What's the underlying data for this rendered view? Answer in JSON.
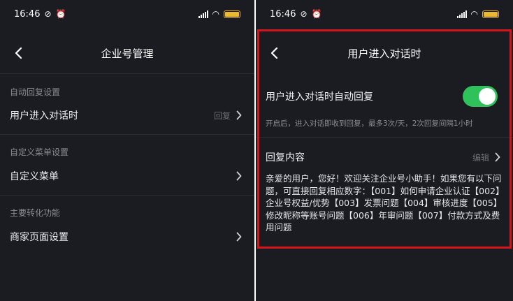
{
  "status_bar": {
    "time": "16:46",
    "icons": [
      "do-not-disturb-icon",
      "alarm-icon",
      "signal-icon",
      "wifi-icon",
      "battery-icon"
    ],
    "battery_color": "#e8b931"
  },
  "left_screen": {
    "nav": {
      "title": "企业号管理"
    },
    "sections": [
      {
        "header": "自动回复设置",
        "row_label": "用户进入对话时",
        "row_value": "回复"
      },
      {
        "header": "自定义菜单设置",
        "row_label": "自定义菜单",
        "row_value": ""
      },
      {
        "header": "主要转化功能",
        "row_label": "商家页面设置",
        "row_value": ""
      }
    ]
  },
  "right_screen": {
    "nav": {
      "title": "用户进入对话时"
    },
    "auto_reply": {
      "label": "用户进入对话时自动回复",
      "enabled": true,
      "hint": "开启后，进入对话即收到回复，最多3次/天，2次回复间隔1小时"
    },
    "reply_content": {
      "label": "回复内容",
      "action": "编辑",
      "text": "亲爱的用户，您好！欢迎关注企业号小助手！如果您有以下问题，可直接回复相应数字：【001】如何申请企业认证【002】企业号权益/优势【003】发票问题【004】审核进度【005】修改昵称等账号问题【006】年审问题【007】付款方式及费用问题"
    }
  },
  "colors": {
    "background": "#1b1c22",
    "divider": "#2c2d35",
    "toggle_on": "#2fc25b",
    "highlight": "#d4161d",
    "muted_text": "#8a8b93"
  }
}
